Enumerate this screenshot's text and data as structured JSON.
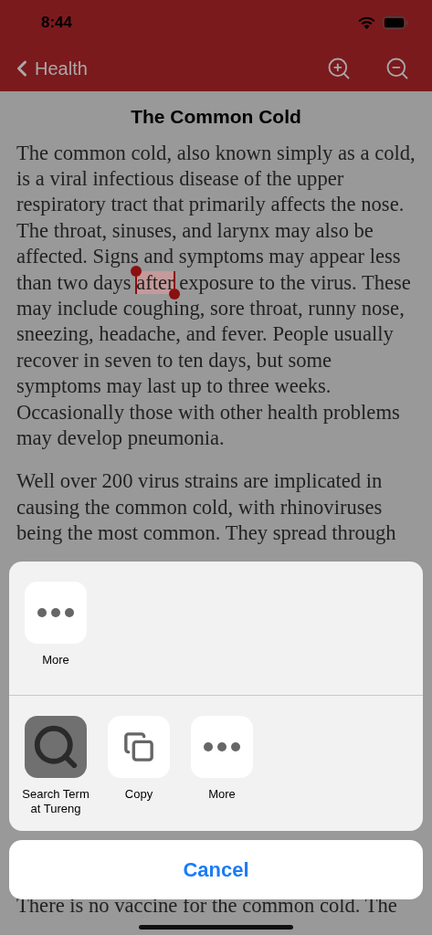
{
  "status_bar": {
    "time": "8:44"
  },
  "nav": {
    "back_label": "Health"
  },
  "article": {
    "title": "The Common Cold",
    "paragraphs": [
      {
        "segments": [
          {
            "text": "The common cold, also known simply as a cold, is a viral infectious disease of the upper respiratory tract that primarily affects the nose. The throat, sinuses, and larynx may also be affected. Signs and symptoms may appear less than two days ",
            "selected": false
          },
          {
            "text": "after",
            "selected": true
          },
          {
            "text": " exposure to the virus. These may include coughing, sore throat, runny nose, sneezing, headache, and fever. People usually recover in seven to ten days, but some symptoms may last up to three weeks. Occasionally those with other health problems may develop pneumonia.",
            "selected": false
          }
        ]
      },
      {
        "segments": [
          {
            "text": "Well over 200 virus strains are implicated in causing the common cold, with rhinoviruses being the most common. They spread through",
            "selected": false
          }
        ]
      },
      {
        "segments": [
          {
            "text": "There is no vaccine for the common cold. The",
            "selected": false
          }
        ]
      }
    ]
  },
  "share_sheet": {
    "rows": [
      [
        {
          "label": "More",
          "kind": "more"
        }
      ],
      [
        {
          "label": "Search Term at Tureng",
          "kind": "search"
        },
        {
          "label": "Copy",
          "kind": "copy"
        },
        {
          "label": "More",
          "kind": "more"
        }
      ]
    ],
    "cancel": "Cancel"
  }
}
